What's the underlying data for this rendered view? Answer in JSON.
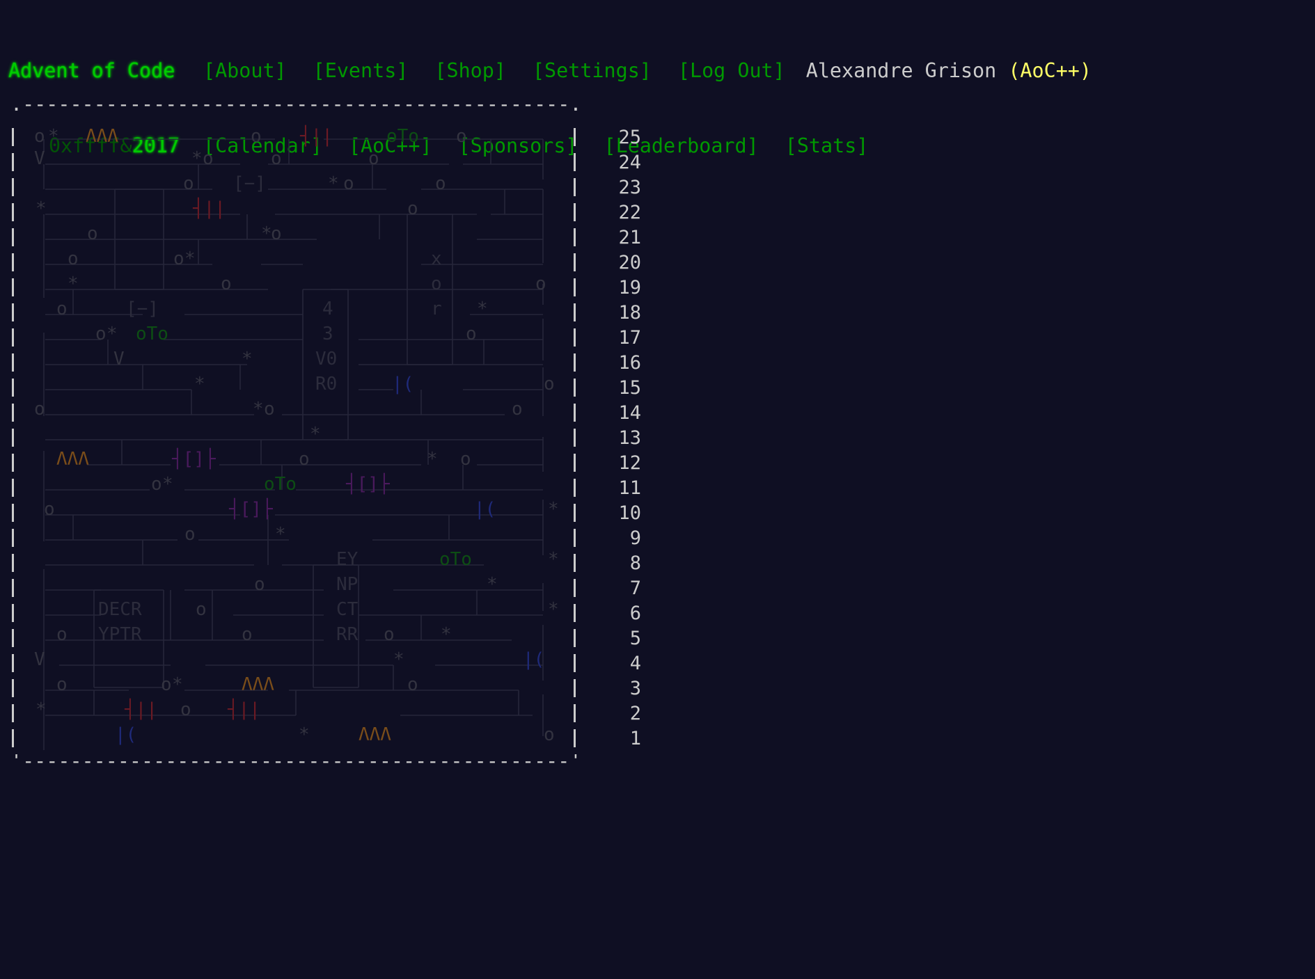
{
  "header": {
    "title": "Advent of Code",
    "year_prefix": "0xffff&",
    "year": "2017",
    "nav_top": [
      "[About]",
      "[Events]",
      "[Shop]",
      "[Settings]",
      "[Log Out]"
    ],
    "nav_bottom": [
      "[Calendar]",
      "[AoC++]",
      "[Sponsors]",
      "[Leaderboard]",
      "[Stats]"
    ],
    "user_name": "Alexandre Grison",
    "user_badge": "(AoC++)"
  },
  "calendar": {
    "days": [
      "25",
      "24",
      "23",
      "22",
      "21",
      "20",
      "19",
      "18",
      "17",
      "16",
      "15",
      "14",
      "13",
      "12",
      "11",
      "10",
      "9",
      "8",
      "7",
      "6",
      "5",
      "4",
      "3",
      "2",
      "1"
    ],
    "chip_labels": {
      "chip_4": "4",
      "chip_3": "3",
      "chip_v0": "V0",
      "chip_r0": "R0",
      "chip_x": "x",
      "chip_o": "o",
      "chip_r": "r",
      "chip_ey": "EY",
      "chip_np": "NP",
      "chip_ct": "CT",
      "chip_rr": "RR",
      "chip_decr": "DECR",
      "chip_yptr": "YPTR",
      "bracket_1": "[−]",
      "bracket_2": "[−]"
    },
    "colors": {
      "background": "#0f0f23",
      "title_green": "#00cc00",
      "nav_green": "#009900",
      "supporter_yellow": "#ffff66",
      "text": "#cccccc"
    }
  }
}
